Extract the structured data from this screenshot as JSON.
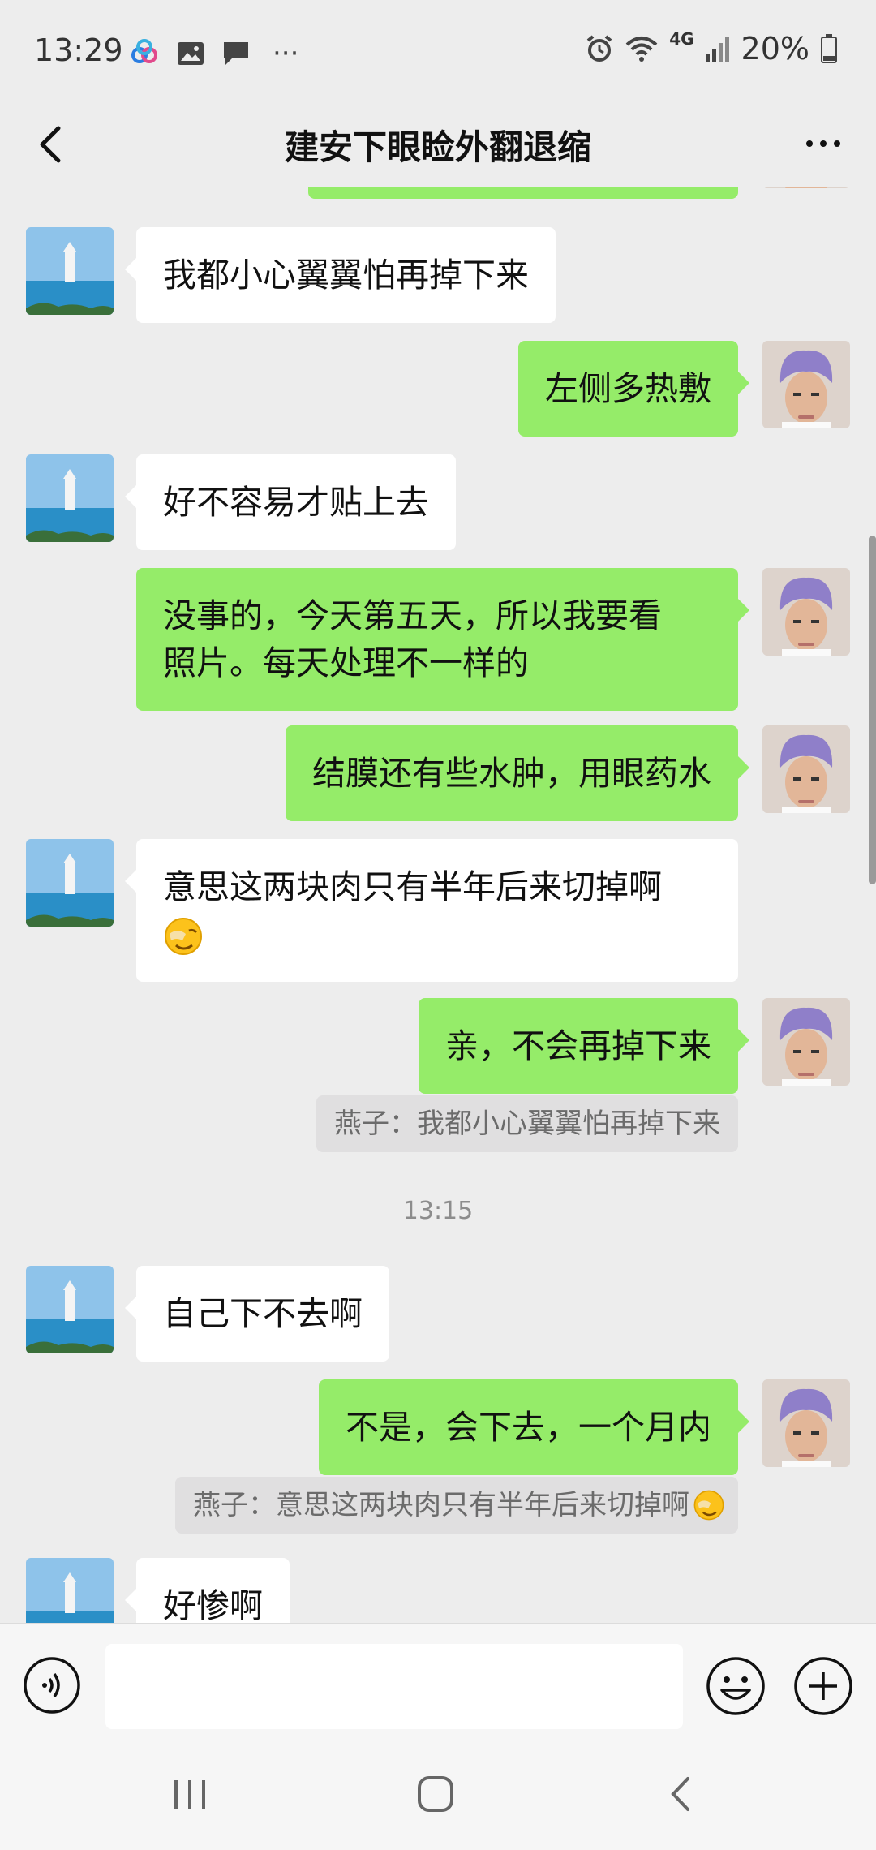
{
  "status_bar": {
    "time": "13:29",
    "network": "4G",
    "battery": "20%",
    "more": "···"
  },
  "header": {
    "title": "建安下眼睑外翻退缩"
  },
  "messages": [
    {
      "side": "in",
      "text": "我都小心翼翼怕再掉下来"
    },
    {
      "side": "out",
      "text": "左侧多热敷"
    },
    {
      "side": "in",
      "text": "好不容易才贴上去"
    },
    {
      "side": "out",
      "line1": "没事的，今天第五天，所以我要看",
      "line2": "照片。每天处理不一样的"
    },
    {
      "side": "out",
      "text": "结膜还有些水肿，用眼药水"
    },
    {
      "side": "in",
      "text": "意思这两块肉只有半年后来切掉啊"
    },
    {
      "side": "out",
      "text": "亲，不会再掉下来",
      "quote": "燕子：我都小心翼翼怕再掉下来"
    },
    {
      "side": "in",
      "text": "自己下不去啊"
    },
    {
      "side": "out",
      "text": "不是，会下去，一个月内",
      "quote": "燕子：意思这两块肉只有半年后来切掉啊"
    },
    {
      "side": "in",
      "text": "好惨啊"
    }
  ],
  "time_separator": "13:15",
  "input": {
    "value": "",
    "placeholder": ""
  },
  "colors": {
    "background": "#ededed",
    "outgoing_bubble": "#95ec69",
    "incoming_bubble": "#ffffff"
  }
}
